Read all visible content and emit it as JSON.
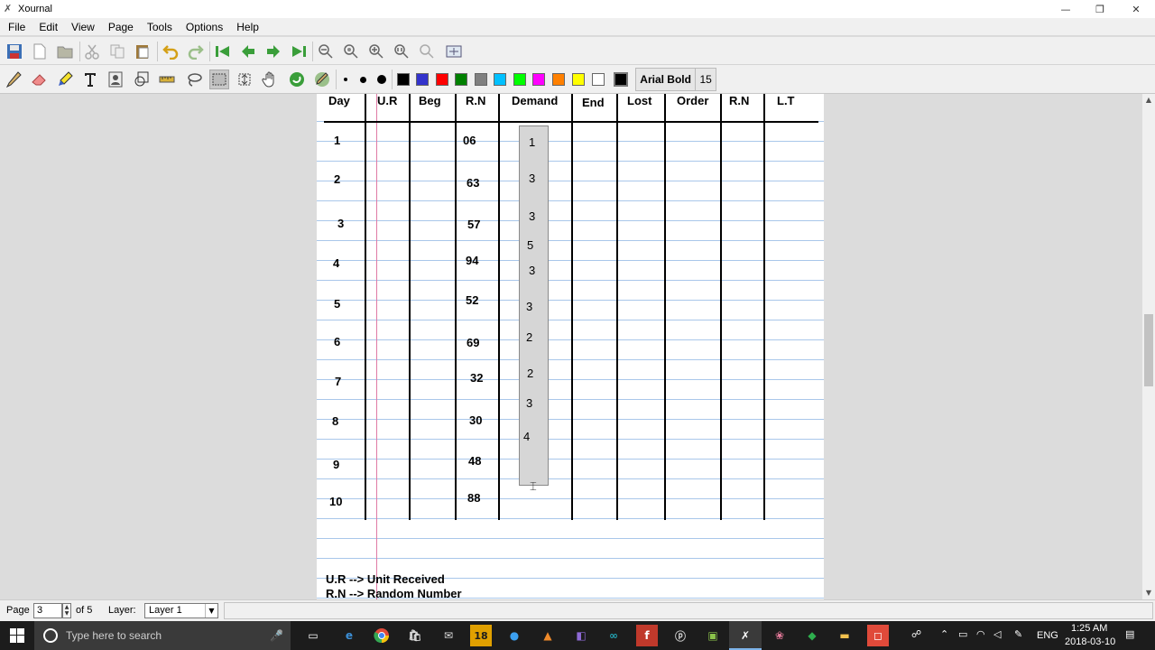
{
  "window": {
    "title": "Xournal",
    "minimize": "—",
    "restore": "❐",
    "close": "✕"
  },
  "menu": [
    "File",
    "Edit",
    "View",
    "Page",
    "Tools",
    "Options",
    "Help"
  ],
  "toolbar": {
    "font_name": "Arial Bold",
    "font_size": "15",
    "colors": [
      "#000000",
      "#3333cc",
      "#ff0000",
      "#008000",
      "#808080",
      "#00c0ff",
      "#00ff00",
      "#ff00ff",
      "#ff8000",
      "#ffff00",
      "#ffffff",
      "#000000"
    ],
    "tools_icons": [
      "pen-icon",
      "eraser-icon",
      "highlighter-icon",
      "text-icon",
      "image-icon",
      "shape-recognizer-icon",
      "ruler-icon",
      "lasso-icon",
      "rect-select-icon",
      "vertical-space-icon",
      "hand-icon",
      "default-icon",
      "default-pen-icon"
    ]
  },
  "sheet": {
    "headers": [
      "Day",
      "U.R",
      "Beg",
      "R.N",
      "Demand",
      "End",
      "Lost",
      "Order",
      "R.N",
      "L.T"
    ],
    "days": [
      "1",
      "2",
      "3",
      "4",
      "5",
      "6",
      "7",
      "8",
      "9",
      "10"
    ],
    "rn": [
      "06",
      "63",
      "57",
      "94",
      "52",
      "69",
      "32",
      "30",
      "48",
      "88"
    ],
    "demand": [
      "1",
      "3",
      "3",
      "5",
      "3",
      "3",
      "2",
      "2",
      "3",
      "4"
    ],
    "note1": "U.R --> Unit Received",
    "note2": "R.N --> Random Number"
  },
  "status": {
    "page_label": "Page",
    "page_value": "3",
    "of_label": "of 5",
    "layer_label": "Layer:",
    "layer_value": "Layer 1"
  },
  "taskbar": {
    "search_placeholder": "Type here to search",
    "lang": "ENG",
    "time": "1:25 AM",
    "date": "2018-03-10"
  }
}
